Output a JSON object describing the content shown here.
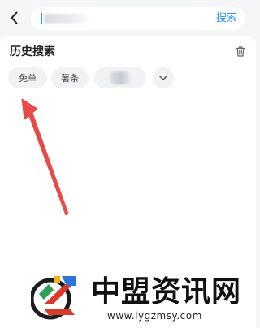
{
  "header": {
    "back_icon": "chevron-left-icon",
    "search": {
      "value": "",
      "placeholder": ""
    },
    "search_button_label": "搜索"
  },
  "history": {
    "title": "历史搜索",
    "clear_icon": "trash-icon",
    "items": [
      {
        "label": "免单"
      },
      {
        "label": "薯条"
      },
      {
        "label": ""
      }
    ],
    "expand_icon": "chevron-down-icon"
  },
  "annotation": {
    "arrow_color": "#e84a4a"
  },
  "watermark": {
    "brand": "中盟资讯网",
    "domain": "www.lygzmsy.com"
  },
  "colors": {
    "background": "#f5f6f8",
    "panel": "#ffffff",
    "accent": "#1f8fff",
    "chip": "#f1f2f4",
    "text": "#222222"
  }
}
